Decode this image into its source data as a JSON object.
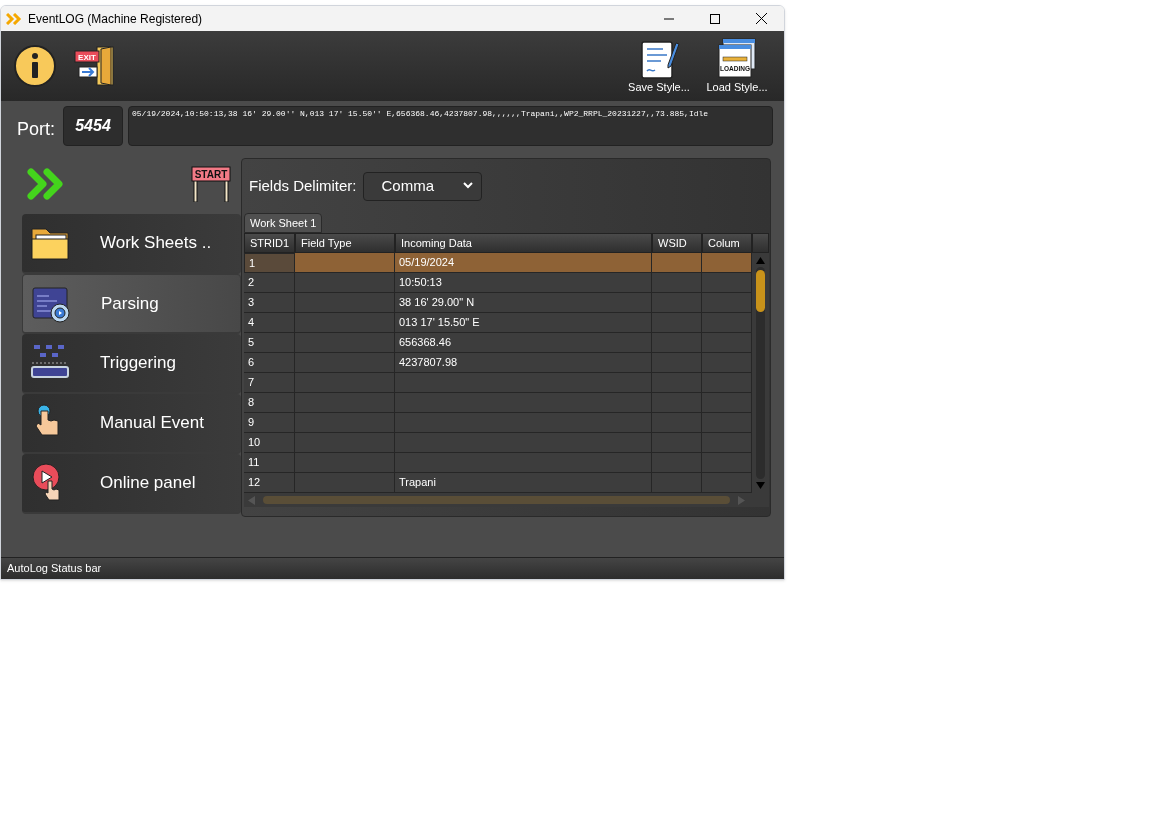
{
  "window": {
    "title": "EventLOG (Machine Registered)"
  },
  "toolbar": {
    "left": [
      {
        "kind": "info"
      },
      {
        "kind": "exit",
        "icon_text": "EXIT"
      }
    ],
    "right": [
      {
        "kind": "save",
        "label": "Save Style..."
      },
      {
        "kind": "load",
        "label": "Load Style...",
        "icon_text": "LOADING"
      }
    ]
  },
  "port": {
    "label": "Port:",
    "value": "5454"
  },
  "incoming_line": "05/19/2024,10:50:13,38 16' 29.00'' N,013 17' 15.50'' E,656368.46,4237807.98,,,,,,Trapani,,WP2_RRPL_20231227,,73.885,Idle",
  "start_sign": "START",
  "sidebar": {
    "items": [
      {
        "kind": "folder",
        "label": "Work Sheets ..",
        "selected": false
      },
      {
        "kind": "parsing",
        "label": "Parsing",
        "selected": true
      },
      {
        "kind": "trigger",
        "label": "Triggering",
        "selected": false
      },
      {
        "kind": "touch",
        "label": "Manual Event",
        "selected": false
      },
      {
        "kind": "play",
        "label": "Online panel",
        "selected": false
      }
    ]
  },
  "delimiter": {
    "label": "Fields Delimiter:",
    "value": "Comma"
  },
  "tabs": [
    {
      "label": "Work Sheet 1",
      "selected": true
    }
  ],
  "table": {
    "columns": [
      "STRID1",
      "Field Type",
      "Incoming Data",
      "WSID",
      "Colum"
    ],
    "rows": [
      {
        "strid": "1",
        "incoming": "05/19/2024",
        "selected": true
      },
      {
        "strid": "2",
        "incoming": "10:50:13",
        "selected": false
      },
      {
        "strid": "3",
        "incoming": "38 16' 29.00\" N",
        "selected": false
      },
      {
        "strid": "4",
        "incoming": "013 17' 15.50\" E",
        "selected": false
      },
      {
        "strid": "5",
        "incoming": "656368.46",
        "selected": false
      },
      {
        "strid": "6",
        "incoming": "4237807.98",
        "selected": false
      },
      {
        "strid": "7",
        "selected": false
      },
      {
        "strid": "8",
        "selected": false
      },
      {
        "strid": "9",
        "selected": false
      },
      {
        "strid": "10",
        "selected": false
      },
      {
        "strid": "11",
        "selected": false
      },
      {
        "strid": "12",
        "incoming": "Trapani",
        "selected": false
      }
    ]
  },
  "status_bar": "AutoLog Status bar"
}
